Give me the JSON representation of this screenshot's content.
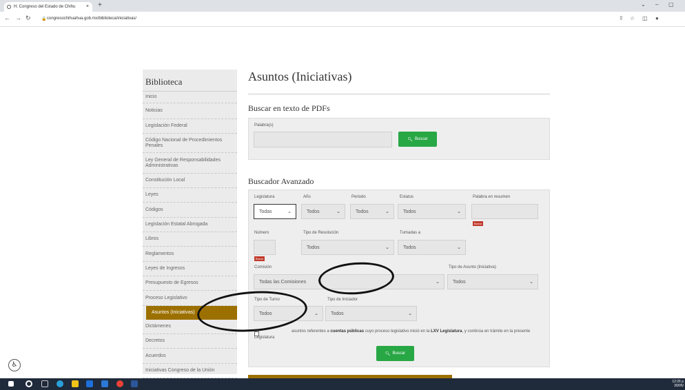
{
  "browser": {
    "tab_title": "H. Congreso del Estado de Chihu",
    "tab_close": "×",
    "new_tab": "+",
    "url": "congresochihuahua.gob.mx/biblioteca/iniciativas/"
  },
  "sidebar": {
    "title": "Biblioteca",
    "items": [
      {
        "label": "Inicio"
      },
      {
        "label": "Noticias"
      },
      {
        "label": "Legislación Federal"
      },
      {
        "label": "Código Nacional de Procedimientos Penales"
      },
      {
        "label": "Ley General de Responsabilidades Administrativas"
      },
      {
        "label": "Constitución Local"
      },
      {
        "label": "Leyes"
      },
      {
        "label": "Códigos"
      },
      {
        "label": "Legislación Estatal Abrogada"
      },
      {
        "label": "Libros"
      },
      {
        "label": "Reglamentos"
      },
      {
        "label": "Leyes de Ingresos"
      },
      {
        "label": "Presupuesto de Egresos"
      },
      {
        "label": "Proceso Legislativo"
      },
      {
        "label": "Asuntos (Iniciativas)"
      },
      {
        "label": "Dictámenes"
      },
      {
        "label": "Decretos"
      },
      {
        "label": "Acuerdos"
      },
      {
        "label": "Iniciativas Congreso de la Unión"
      }
    ]
  },
  "main": {
    "title": "Asuntos (Iniciativas)",
    "pdf_search": {
      "heading": "Buscar en texto de PDFs",
      "label": "Palabra(s)",
      "button": "Buscar"
    },
    "advanced": {
      "heading": "Buscador Avanzado",
      "legislatura_label": "Legislatura",
      "legislatura_value": "Todas",
      "anio_label": "Año",
      "anio_value": "Todos",
      "periodo_label": "Periodo",
      "periodo_value": "Todos",
      "estatus_label": "Estatus",
      "estatus_value": "Todos",
      "resumen_label": "Palabra en resumen",
      "borrar": "Borrar",
      "numero_label": "Número",
      "resolucion_label": "Tipo de Resolución",
      "resolucion_value": "Todos",
      "turnadas_label": "Turnadas a",
      "turnadas_value": "Todos",
      "comision_label": "Comisión",
      "comision_value": "Todas las Comisiones",
      "tipo_asunto_label": "Tipo de Asunto (Iniciativa)",
      "tipo_asunto_value": "Todos",
      "tipo_turno_label": "Tipo de Turno",
      "tipo_turno_value": "Todos",
      "tipo_iniciador_label": "Tipo de Iniciador",
      "tipo_iniciador_value": "Todos",
      "checkbox_text_1": "asuntos referentes a ",
      "checkbox_bold_1": "cuentas públicas",
      "checkbox_text_2": " cuyo proceso legislativo inició en la ",
      "checkbox_bold_2": "LXV Legislatura",
      "checkbox_text_3": ", y continúa en trámite en la presente Legislatura",
      "button": "Buscar"
    }
  },
  "taskbar": {
    "time": "12:26 p",
    "date": "30/05/"
  }
}
